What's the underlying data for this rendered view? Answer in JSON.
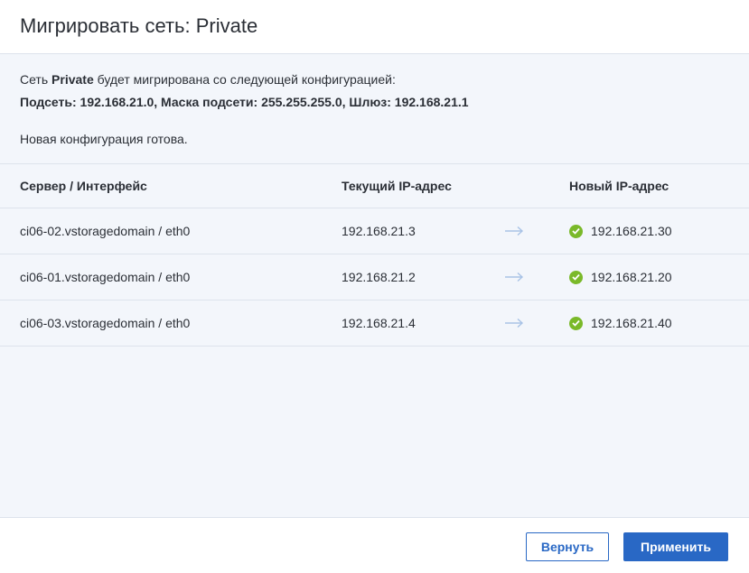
{
  "dialog": {
    "title": "Мигрировать сеть: Private"
  },
  "intro": {
    "prefix": "Сеть ",
    "network_name": "Private",
    "suffix": " будет мигрирована со следующей конфигурацией:",
    "config": "Подсеть: 192.168.21.0, Маска подсети: 255.255.255.0, Шлюз: 192.168.21.1",
    "status": "Новая конфигурация готова."
  },
  "table": {
    "headers": {
      "server": "Сервер / Интерфейс",
      "current": "Текущий IP-адрес",
      "new": "Новый IP-адрес"
    },
    "rows": [
      {
        "server": "ci06-02.vstoragedomain / eth0",
        "current": "192.168.21.3",
        "new": "192.168.21.30",
        "status_icon": "check-circle-icon"
      },
      {
        "server": "ci06-01.vstoragedomain / eth0",
        "current": "192.168.21.2",
        "new": "192.168.21.20",
        "status_icon": "check-circle-icon"
      },
      {
        "server": "ci06-03.vstoragedomain / eth0",
        "current": "192.168.21.4",
        "new": "192.168.21.40",
        "status_icon": "check-circle-icon"
      }
    ]
  },
  "footer": {
    "back_label": "Вернуть",
    "apply_label": "Применить"
  },
  "colors": {
    "accent": "#2968c5",
    "success": "#7ab929",
    "arrow": "#a9c3e6",
    "body_bg": "#f3f6fb"
  }
}
